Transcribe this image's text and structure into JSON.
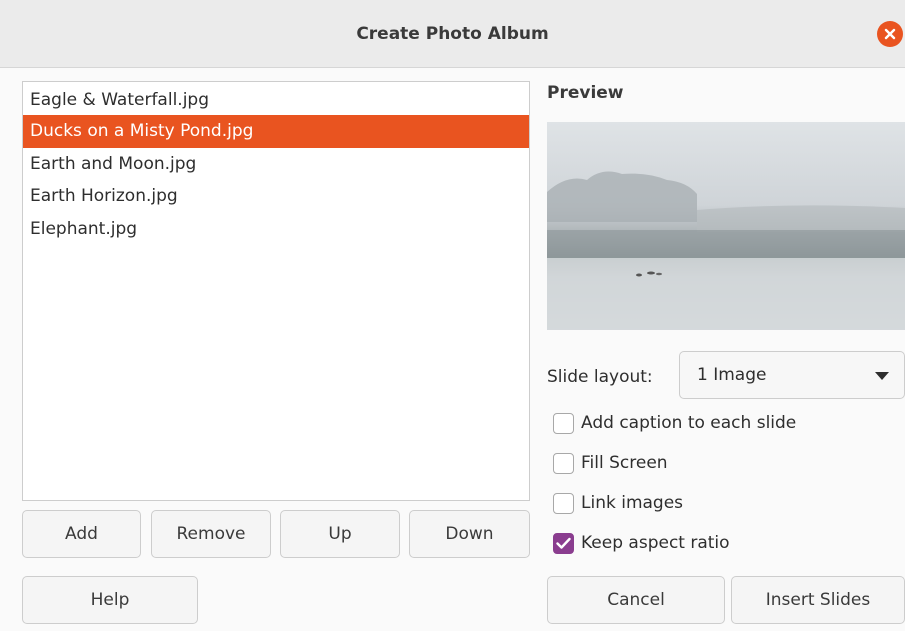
{
  "dialog": {
    "title": "Create Photo Album",
    "close_icon": "close-icon",
    "accent_color": "#e95420",
    "checkbox_color": "#8a3d8f"
  },
  "file_list": {
    "items": [
      {
        "name": "Eagle & Waterfall.jpg",
        "selected": false
      },
      {
        "name": "Ducks on a Misty Pond.jpg",
        "selected": true
      },
      {
        "name": "Earth and Moon.jpg",
        "selected": false
      },
      {
        "name": "Earth Horizon.jpg",
        "selected": false
      },
      {
        "name": "Elephant.jpg",
        "selected": false
      }
    ]
  },
  "list_buttons": {
    "add": "Add",
    "remove": "Remove",
    "up": "Up",
    "down": "Down"
  },
  "preview": {
    "label": "Preview"
  },
  "options": {
    "slide_layout_label": "Slide layout:",
    "slide_layout_value": "1 Image",
    "caption": {
      "label": "Add caption to each slide",
      "checked": false
    },
    "fill_screen": {
      "label": "Fill Screen",
      "checked": false
    },
    "link_images": {
      "label": "Link images",
      "checked": false
    },
    "keep_aspect": {
      "label": "Keep aspect ratio",
      "checked": true
    }
  },
  "footer": {
    "help": "Help",
    "cancel": "Cancel",
    "insert": "Insert Slides"
  }
}
